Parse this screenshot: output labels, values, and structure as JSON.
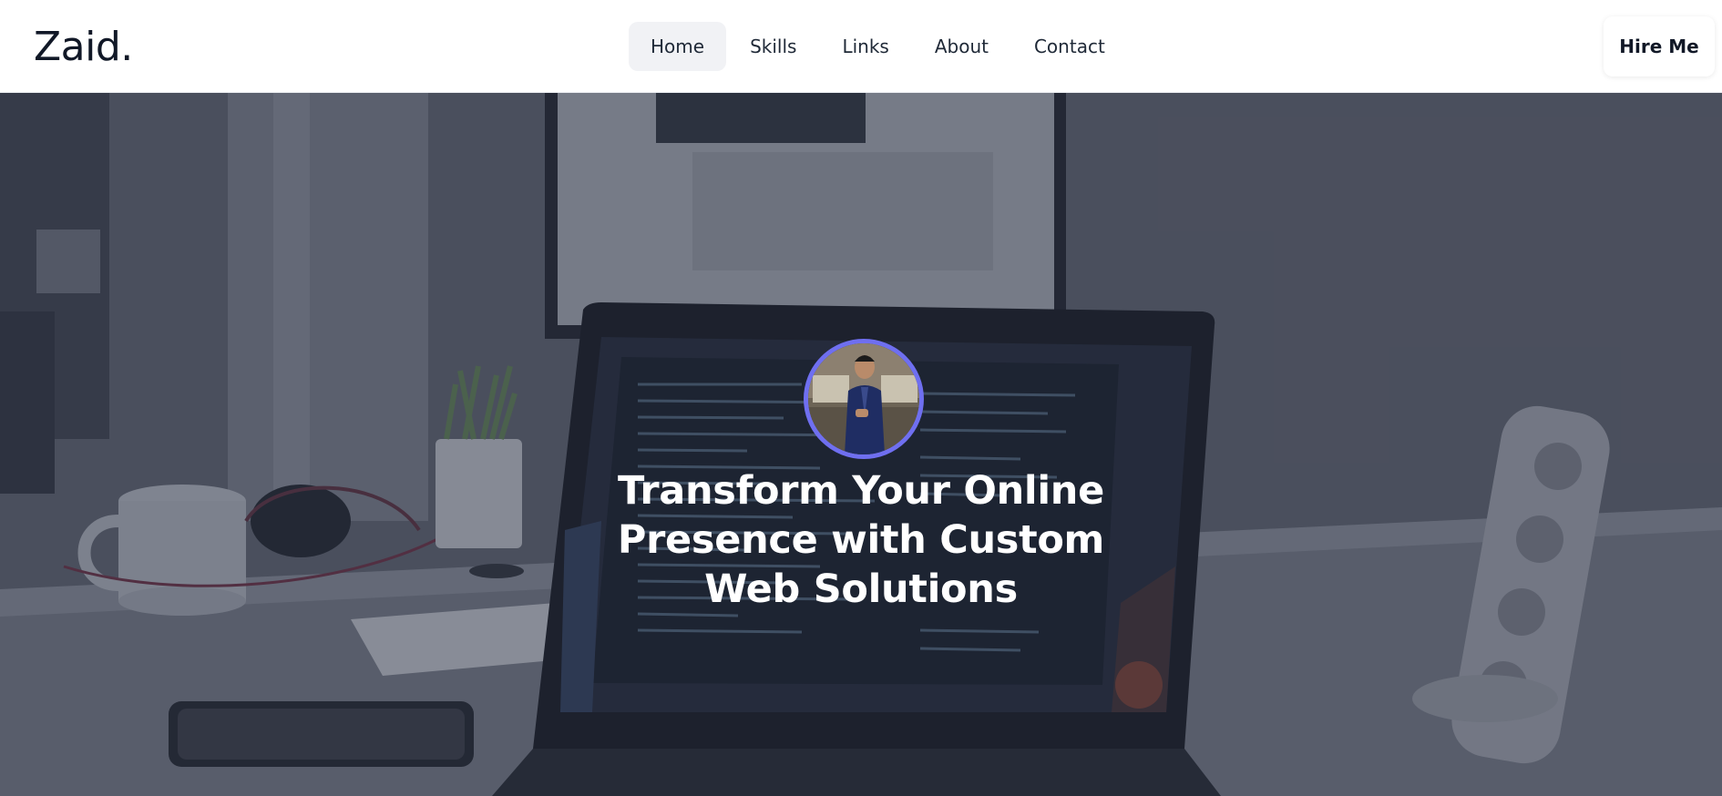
{
  "brand": {
    "name": "Zaid."
  },
  "nav": {
    "items": [
      {
        "label": "Home",
        "active": true
      },
      {
        "label": "Skills",
        "active": false
      },
      {
        "label": "Links",
        "active": false
      },
      {
        "label": "About",
        "active": false
      },
      {
        "label": "Contact",
        "active": false
      }
    ],
    "cta_label": "Hire Me"
  },
  "hero": {
    "title": "Transform Your Online Presence with Custom Web Solutions",
    "avatar_border_color": "#6f6ff0",
    "overlay_color": "#1b2136"
  }
}
